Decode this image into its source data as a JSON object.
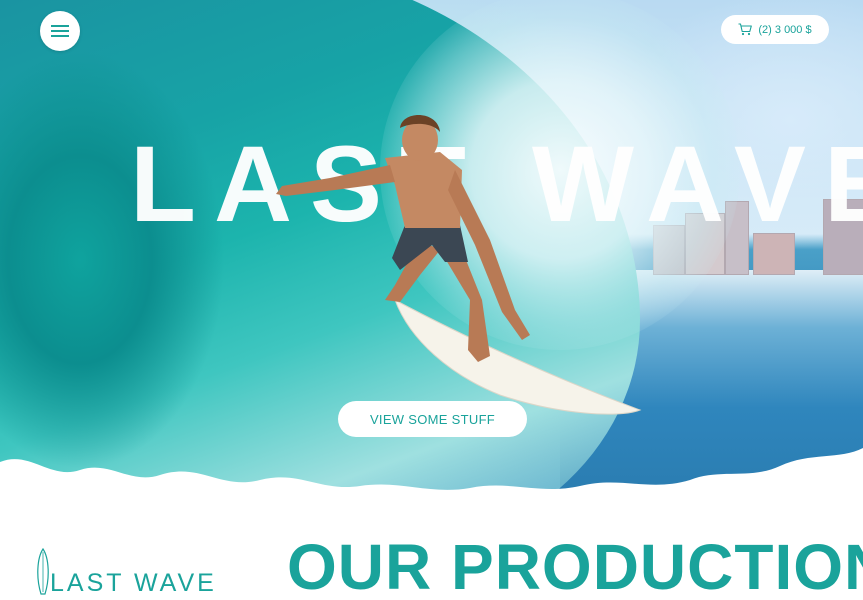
{
  "header": {
    "menu_icon": "hamburger-menu-icon",
    "cart": {
      "icon": "shopping-cart-icon",
      "label": "(2) 3 000 $"
    }
  },
  "hero": {
    "title": "LAST WAVE",
    "cta_label": "VIEW SOME STUFF"
  },
  "brand": {
    "logo_icon": "surfboard-icon",
    "logo_text": "LAST WAVE"
  },
  "section": {
    "title": "OUR PRODUCTION"
  },
  "colors": {
    "accent": "#1aa39b",
    "white": "#ffffff",
    "wave_teal": "#17a3a6"
  }
}
